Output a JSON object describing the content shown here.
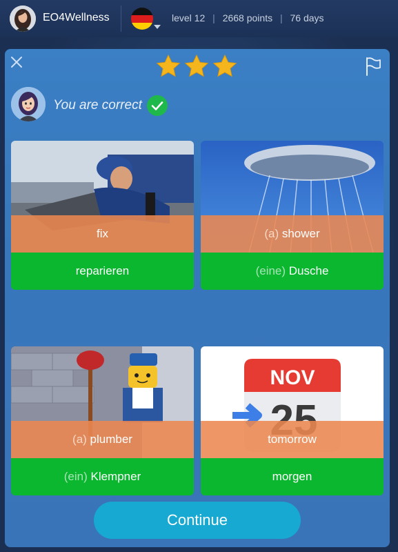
{
  "header": {
    "username": "EO4Wellness",
    "level": "level 12",
    "points": "2668 points",
    "days": "76 days",
    "separator": "|",
    "flag": "germany-flag"
  },
  "modal": {
    "stars": 3,
    "feedback": "You are correct",
    "cards": [
      {
        "en_article": "",
        "en_word": "fix",
        "de_article": "",
        "de_word": "reparieren",
        "image": "mechanic-photo"
      },
      {
        "en_article": "(a)",
        "en_word": "shower",
        "de_article": "(eine)",
        "de_word": "Dusche",
        "image": "shower-head-photo"
      },
      {
        "en_article": "(a)",
        "en_word": "plumber",
        "de_article": "(ein)",
        "de_word": "Klempner",
        "image": "lego-plumber-photo"
      },
      {
        "en_article": "",
        "en_word": "tomorrow",
        "de_article": "",
        "de_word": "morgen",
        "image": "calendar-icon",
        "calendar_month": "NOV",
        "calendar_day": "25"
      }
    ],
    "continue_label": "Continue"
  },
  "colors": {
    "modal_bg": "#3b7fc4",
    "english_band": "#ec8850",
    "german_band": "#0ab72e",
    "continue_button": "#17a9d1",
    "check_green": "#1fb84a",
    "star_gold": "#f5b51c"
  }
}
